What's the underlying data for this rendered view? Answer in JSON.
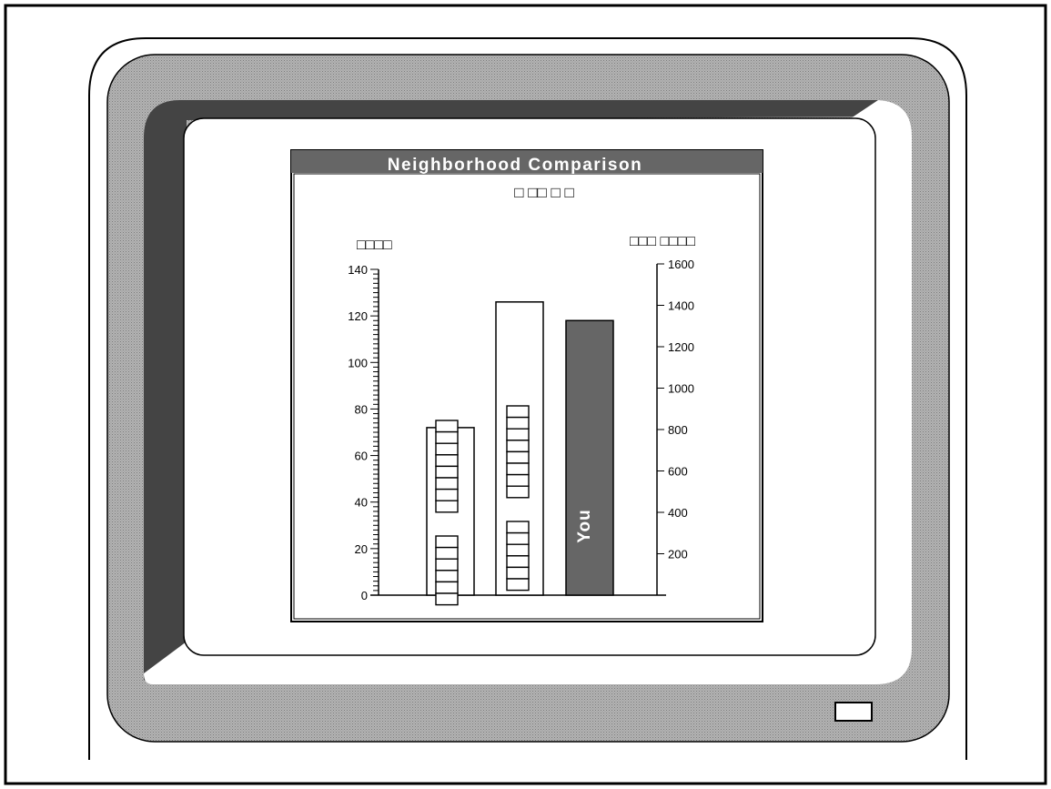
{
  "chart_data": {
    "type": "bar",
    "title": "Neighborhood Comparison",
    "subtitle": "□ □□ □ □",
    "left_axis": {
      "label": "□□□□",
      "min": 0,
      "max": 140,
      "ticks": [
        0,
        20,
        40,
        60,
        80,
        100,
        120,
        140
      ]
    },
    "right_axis": {
      "label": "□□□ □□□□",
      "min": 0,
      "max": 1600,
      "ticks": [
        200,
        400,
        600,
        800,
        1000,
        1200,
        1400,
        1600
      ]
    },
    "bars": [
      {
        "value": 72,
        "label": "",
        "fill": "#ffffff"
      },
      {
        "value": 126,
        "label": "",
        "fill": "#ffffff"
      },
      {
        "value": 118,
        "label": "You",
        "fill": "#666666"
      }
    ],
    "grid": false
  },
  "monitor": {
    "bezel_color": "#a0a0a0",
    "frame_color": "#444444",
    "title_bar_color": "#666666"
  }
}
